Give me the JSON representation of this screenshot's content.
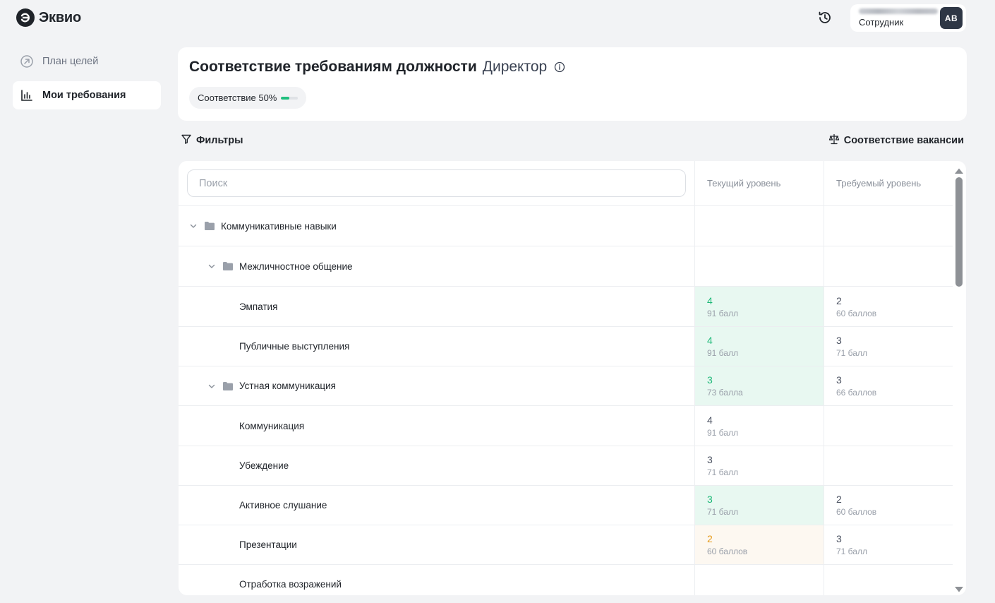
{
  "app": {
    "name": "Эквио"
  },
  "user": {
    "role": "Сотрудник",
    "initials": "АВ"
  },
  "sidebar": {
    "items": [
      {
        "label": "План целей",
        "icon": "goal-arrow-icon"
      },
      {
        "label": "Мои требования",
        "icon": "chart-bars-icon"
      }
    ]
  },
  "header": {
    "title": "Соответствие требованиям должности",
    "position": "Директор",
    "match_label": "Соответствие 50%",
    "match_value": 0.5
  },
  "toolbar": {
    "filters_label": "Фильтры",
    "vacancy_label": "Соответствие вакансии"
  },
  "table": {
    "search_placeholder": "Поиск",
    "columns": {
      "current": "Текущий уровень",
      "required": "Требуемый уровень"
    },
    "rows": [
      {
        "name": "Коммуникативные навыки",
        "type": "group",
        "depth": 0
      },
      {
        "name": "Межличностное общение",
        "type": "group",
        "depth": 1
      },
      {
        "name": "Эмпатия",
        "type": "item",
        "depth": 2,
        "current_level": "4",
        "current_points": "91 балл",
        "current_status": "above",
        "required_level": "2",
        "required_points": "60 баллов"
      },
      {
        "name": "Публичные выступления",
        "type": "item",
        "depth": 2,
        "current_level": "4",
        "current_points": "91 балл",
        "current_status": "above",
        "required_level": "3",
        "required_points": "71 балл"
      },
      {
        "name": "Устная коммуникация",
        "type": "group",
        "depth": 1,
        "current_level": "3",
        "current_points": "73 балла",
        "current_status": "above",
        "required_level": "3",
        "required_points": "66 баллов"
      },
      {
        "name": "Коммуникация",
        "type": "item",
        "depth": 2,
        "current_level": "4",
        "current_points": "91 балл",
        "current_status": "neutral"
      },
      {
        "name": "Убеждение",
        "type": "item",
        "depth": 2,
        "current_level": "3",
        "current_points": "71 балл",
        "current_status": "neutral"
      },
      {
        "name": "Активное слушание",
        "type": "item",
        "depth": 2,
        "current_level": "3",
        "current_points": "71 балл",
        "current_status": "above",
        "required_level": "2",
        "required_points": "60 баллов"
      },
      {
        "name": "Презентации",
        "type": "item",
        "depth": 2,
        "current_level": "2",
        "current_points": "60 баллов",
        "current_status": "below",
        "required_level": "3",
        "required_points": "71 балл"
      },
      {
        "name": "Отработка возражений",
        "type": "item",
        "depth": 2
      }
    ]
  },
  "colors": {
    "accent_green": "#1db877",
    "warning_orange": "#e59a1a",
    "above_bg": "#e8f8f1",
    "below_bg": "#fdf8f1"
  }
}
